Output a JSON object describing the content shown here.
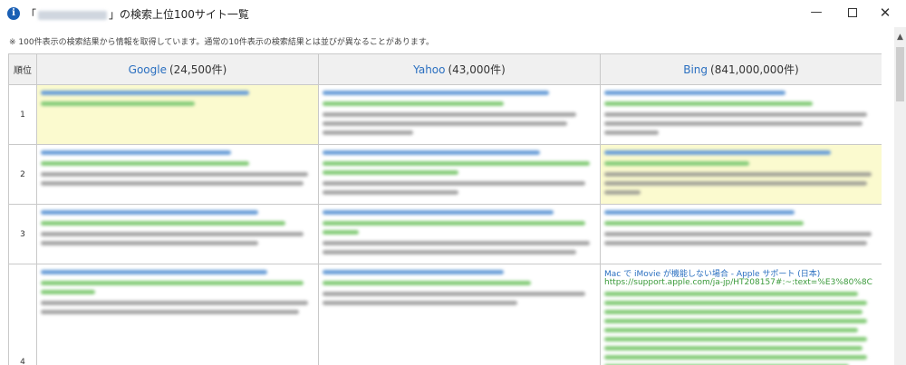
{
  "window": {
    "icon_glyph": "i",
    "title_prefix": "「",
    "title_suffix": "」の検索上位100サイト一覧",
    "minimize_glyph": "—",
    "close_glyph": "✕"
  },
  "note": "※ 100件表示の検索結果から情報を取得しています。通常の10件表示の検索結果とは並びが異なることがあります。",
  "table": {
    "rank_header": "順位",
    "engines": [
      {
        "name": "Google",
        "count": "(24,500件)"
      },
      {
        "name": "Yahoo",
        "count": "(43,000件)"
      },
      {
        "name": "Bing",
        "count": "(841,000,000件)"
      }
    ],
    "ranks": [
      "1",
      "2",
      "3",
      "4"
    ],
    "bing_rank4": {
      "title": "Mac で iMovie が機能しない場合 - Apple サポート (日本)",
      "url": "https://support.apple.com/ja-jp/HT208157#:~:text=%E3%80%8C"
    }
  },
  "colors": {
    "link": "#2a6fc0",
    "url": "#3a9a3a",
    "highlight": "#fbfacf",
    "header_bg": "#f0f0f0"
  },
  "scrollbar": {
    "up_glyph": "▲"
  }
}
